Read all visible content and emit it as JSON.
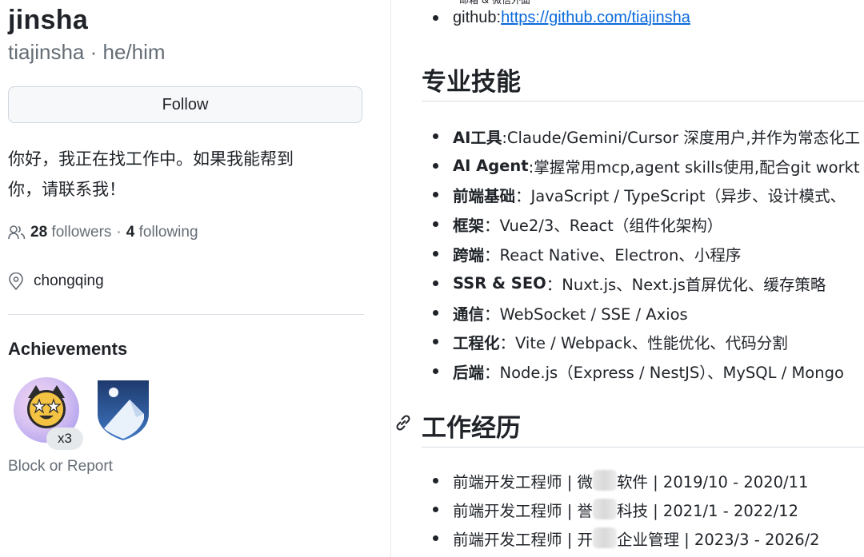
{
  "profile": {
    "name": "jinsha",
    "handle": "tiajinsha · he/him",
    "follow_label": "Follow",
    "bio_line1": "你好，我正在找工作中。如果我能帮到",
    "bio_line2": "你，请联系我！",
    "followers_count": "28",
    "followers_label": "followers",
    "sep": "·",
    "following_count": "4",
    "following_label": "following",
    "location": "chongqing"
  },
  "achievements": {
    "title": "Achievements",
    "badge1_count": "x3",
    "block_report": "Block or Report"
  },
  "readme": {
    "top_clip": "邮箱 & 微信外面",
    "github_label": "github:",
    "github_url": "https://github.com/tiajinsha",
    "skills_heading": "专业技能",
    "skills": [
      {
        "label": "AI工具",
        "text": ":Claude/Gemini/Cursor 深度用户,并作为常态化工"
      },
      {
        "label": "AI Agent",
        "text": ":掌握常用mcp,agent skills使用,配合git workt"
      },
      {
        "label": "前端基础",
        "text": "：JavaScript / TypeScript（异步、设计模式、"
      },
      {
        "label": "框架",
        "text": "：Vue2/3、React（组件化架构）"
      },
      {
        "label": "跨端",
        "text": "：React Native、Electron、小程序"
      },
      {
        "label": "SSR & SEO",
        "text": "：Nuxt.js、Next.js首屏优化、缓存策略"
      },
      {
        "label": "通信",
        "text": "：WebSocket / SSE / Axios"
      },
      {
        "label": "工程化",
        "text": "：Vite / Webpack、性能优化、代码分割"
      },
      {
        "label": "后端",
        "text": "：Node.js（Express / NestJS）、MySQL / Mongo"
      }
    ],
    "work_heading": "工作经历",
    "jobs": [
      {
        "pre": "前端开发工程师 | 微",
        "post": "软件 | 2019/10 - 2020/11"
      },
      {
        "pre": "前端开发工程师 | 誉",
        "post": "科技 | 2021/1 - 2022/12"
      },
      {
        "pre": "前端开发工程师 | 开",
        "post": "企业管理 | 2023/3 - 2026/2"
      }
    ]
  },
  "colors": {
    "link": "#0969da",
    "muted": "#656d76",
    "text": "#1f2328"
  },
  "icons": [
    "people-icon",
    "location-icon",
    "link-icon",
    "starstruck-cat-badge",
    "arctic-code-vault-badge"
  ]
}
